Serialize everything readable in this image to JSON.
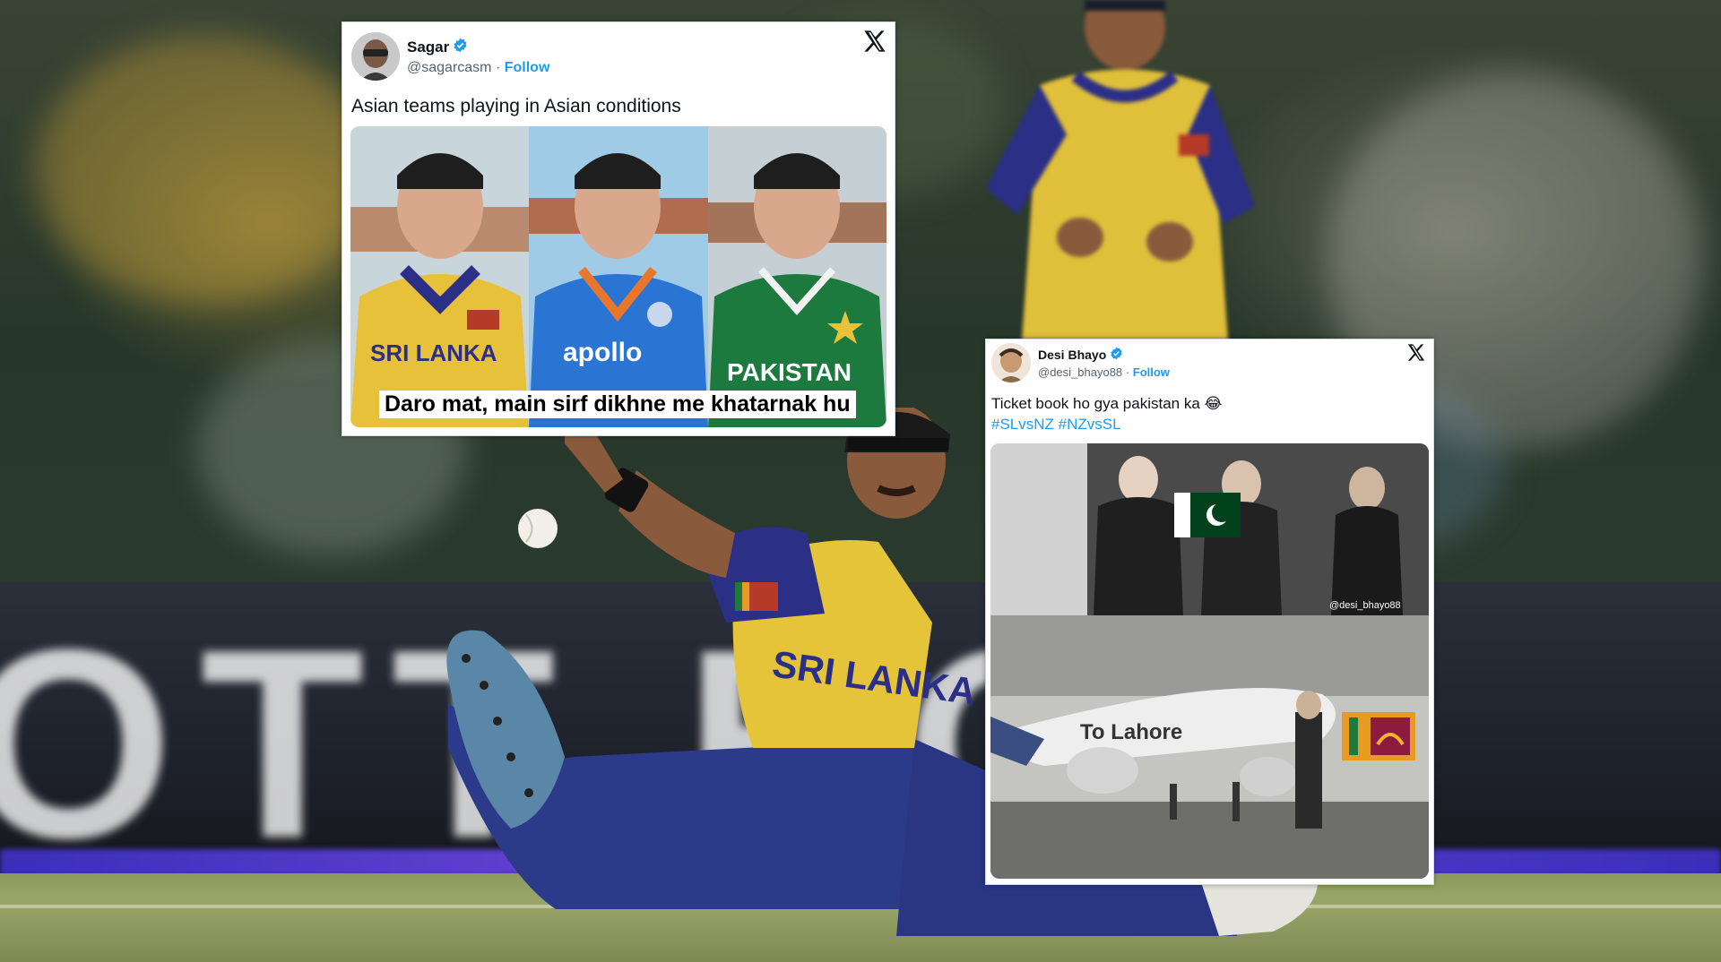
{
  "scene": {
    "description_colors": {
      "jersey": "#e8c23a",
      "jersey_trim": "#2b2f86",
      "grass": "#8c9a5e"
    },
    "board_text": "OTT BO   Y"
  },
  "tweet1": {
    "name": "Sagar",
    "handle": "@sagarcasm",
    "separator": "·",
    "follow": "Follow",
    "text": "Asian teams playing in Asian conditions",
    "meme": {
      "jersey_labels": [
        "SRI LANKA",
        "apollo",
        "PAKISTAN"
      ],
      "caption": "Daro mat, main sirf dikhne me khatarnak hu"
    }
  },
  "tweet2": {
    "name": "Desi Bhayo",
    "handle": "@desi_bhayo88",
    "separator": "·",
    "follow": "Follow",
    "text": "Ticket book ho gya pakistan ka 😂",
    "hashtags": [
      "#SLvsNZ",
      "#NZvsSL"
    ],
    "meme": {
      "watermark": "@desi_bhayo88",
      "plane_label": "To Lahore"
    }
  },
  "icons": [
    "x-logo-icon",
    "verified-badge-icon"
  ],
  "colors": {
    "link": "#1d9bf0",
    "text": "#0f1419",
    "muted": "#536471"
  }
}
